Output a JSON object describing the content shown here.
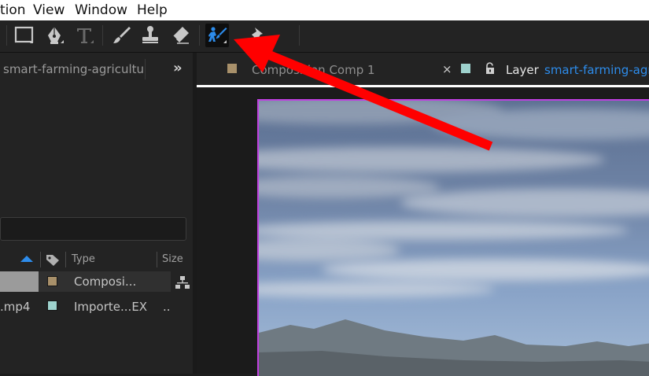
{
  "menu": {
    "items": [
      "tion",
      "View",
      "Window",
      "Help"
    ]
  },
  "toolbar": {
    "tools": [
      "rectangle-tool",
      "pen-tool",
      "type-tool",
      "brush-tool",
      "clone-stamp-tool",
      "eraser-tool",
      "roto-brush-tool",
      "puppet-pin-tool"
    ],
    "active_tool": "roto-brush-tool",
    "accent_color": "#2d8ceb"
  },
  "project_panel": {
    "title": "smart-farming-agricultur",
    "expand_label": "»",
    "columns": {
      "type": "Type",
      "size": "Size"
    },
    "rows": [
      {
        "name": "",
        "type": "Composi...",
        "size": "",
        "swatch_color": "#a8906a",
        "selected": true
      },
      {
        "name": ".mp4",
        "type": "Importe...EX",
        "size": "..",
        "swatch_color": "#9ed2cd",
        "selected": false
      }
    ]
  },
  "viewer_tabs": {
    "composition": {
      "label": "Composition  Comp 1",
      "swatch_color": "#a8906a"
    },
    "close_label": "×",
    "layer": {
      "prefix": "Layer",
      "name": "smart-farming-agr",
      "swatch_color": "#9ed2cd",
      "name_color": "#2d8ceb"
    }
  },
  "annotation": {
    "arrow_color": "#ff0000",
    "target": "roto-brush-tool"
  }
}
